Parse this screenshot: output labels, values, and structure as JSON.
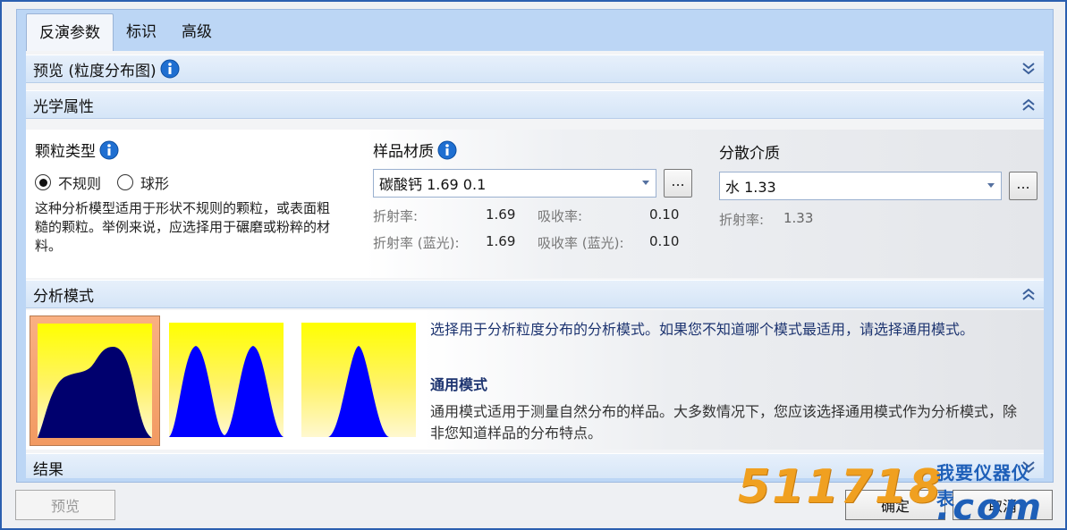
{
  "tabs": [
    {
      "label": "反演参数",
      "active": true
    },
    {
      "label": "标识",
      "active": false
    },
    {
      "label": "高级",
      "active": false
    }
  ],
  "sections": {
    "preview": "预览 (粒度分布图)",
    "optical": "光学属性",
    "analysis": "分析模式",
    "results": "结果"
  },
  "particle_type": {
    "title": "颗粒类型",
    "options": [
      {
        "label": "不规则",
        "selected": true
      },
      {
        "label": "球形",
        "selected": false
      }
    ],
    "description": "这种分析模型适用于形状不规则的颗粒，或表面粗糙的颗粒。举例来说，应选择用于碾磨或粉粹的材料。"
  },
  "sample_material": {
    "title": "样品材质",
    "value": "碳酸钙 1.69 0.1",
    "more_label": "...",
    "ri_label": "折射率:",
    "ri_value": "1.69",
    "abs_label": "吸收率:",
    "abs_value": "0.10",
    "ri_blue_label": "折射率 (蓝光):",
    "ri_blue_value": "1.69",
    "abs_blue_label": "吸收率 (蓝光):",
    "abs_blue_value": "0.10"
  },
  "dispersant": {
    "title": "分散介质",
    "value": "水 1.33",
    "more_label": "...",
    "ri_label": "折射率:",
    "ri_value": "1.33"
  },
  "analysis_mode": {
    "intro": "选择用于分析粒度分布的分析模式。如果您不知道哪个模式最适用，请选择通用模式。",
    "mode_title": "通用模式",
    "mode_desc": "通用模式适用于测量自然分布的样品。大多数情况下，您应该选择通用模式作为分析模式，除非您知道样品的分布特点。",
    "modes": [
      "general-mode",
      "multimodal-mode",
      "single-narrow-mode"
    ]
  },
  "footer": {
    "preview": "预览",
    "ok": "确定",
    "cancel": "取消"
  },
  "watermark": {
    "number": "511718",
    "dot": ".",
    "com": "com",
    "cn": "我要仪器仪表"
  },
  "colors": {
    "accent": "#2b5fb0",
    "mode_fill": "#0000ff",
    "mode_dark_fill": "#00006e",
    "mode_bg_top": "#ffff00",
    "selected_mode": "#f29a62"
  }
}
